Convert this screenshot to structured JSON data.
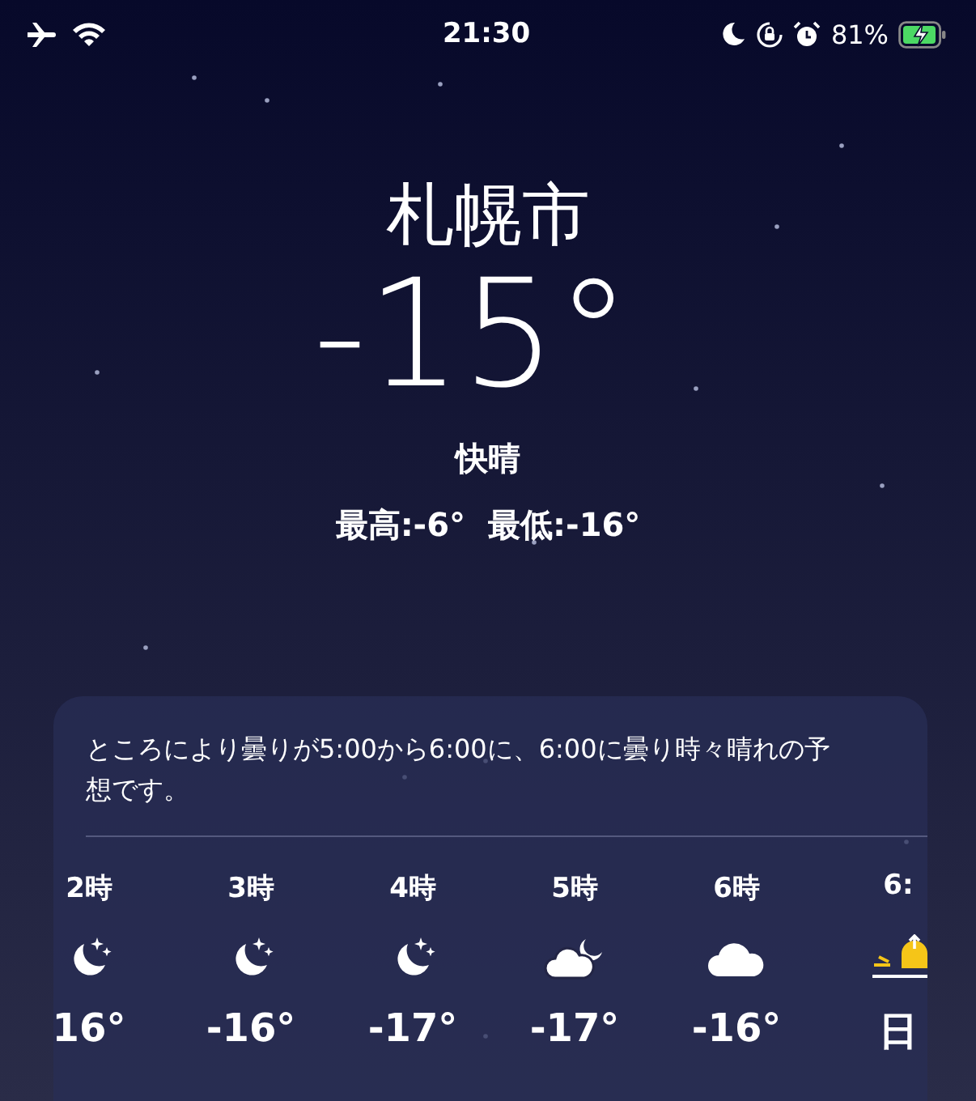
{
  "status_bar": {
    "time": "21:30",
    "battery": "81%"
  },
  "city": "札幌市",
  "temperature": "-15°",
  "condition": "快晴",
  "high": "最高:-6°",
  "low": "最低:-16°",
  "forecast_card": {
    "summary": "ところにより曇りが5:00から6:00に、6:00に曇り時々晴れの予想です。",
    "hours": [
      {
        "time": "2時",
        "kind": "moon-stars",
        "temp": "16°"
      },
      {
        "time": "3時",
        "kind": "moon-stars",
        "temp": "-16°"
      },
      {
        "time": "4時",
        "kind": "moon-stars",
        "temp": "-17°"
      },
      {
        "time": "5時",
        "kind": "cloud-moon",
        "temp": "-17°"
      },
      {
        "time": "6時",
        "kind": "cloud",
        "temp": "-16°"
      },
      {
        "time": "6:",
        "kind": "sunrise",
        "temp": "日"
      }
    ]
  }
}
